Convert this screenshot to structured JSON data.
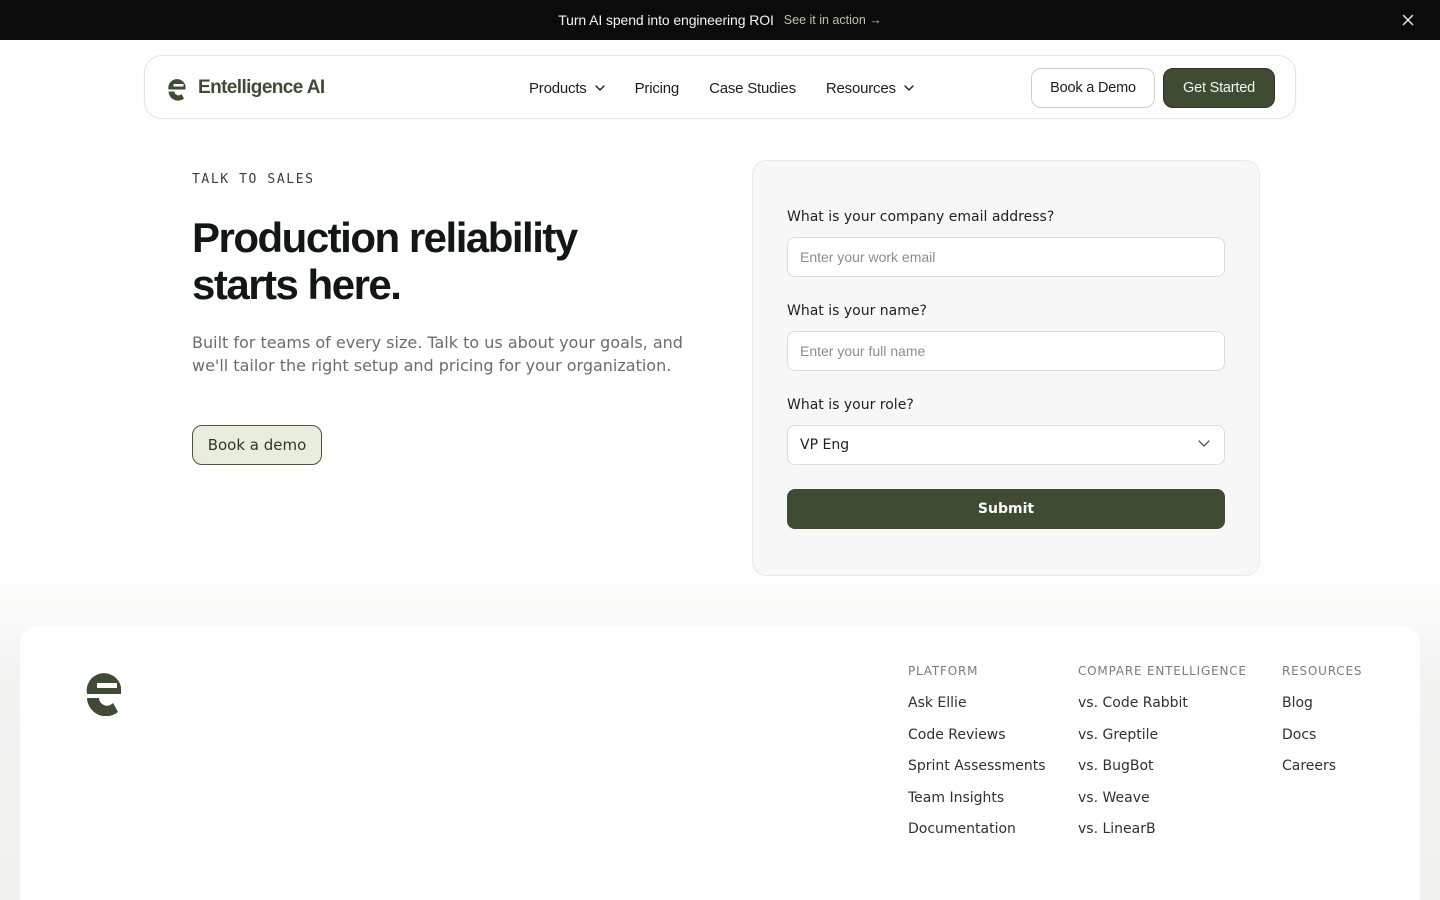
{
  "announcement": {
    "message": "Turn AI spend into engineering ROI",
    "cta": "See it in action →",
    "close_icon": "close-icon"
  },
  "brand": {
    "name": "Entelligence AI",
    "logo_icon": "entelligence-logo-icon",
    "color": "#3f4b33"
  },
  "nav": {
    "items": [
      {
        "label": "Products",
        "has_dropdown": true
      },
      {
        "label": "Pricing",
        "has_dropdown": false
      },
      {
        "label": "Case Studies",
        "has_dropdown": false
      },
      {
        "label": "Resources",
        "has_dropdown": true
      }
    ],
    "book_demo": "Book a Demo",
    "get_started": "Get Started"
  },
  "hero": {
    "eyebrow": "TALK TO SALES",
    "title_line1": "Production reliability",
    "title_line2": "starts here.",
    "subtitle": "Built for teams of every size. Talk to us about your goals, and we'll tailor the right setup and pricing for your organization.",
    "cta": "Book a demo"
  },
  "form": {
    "email_label": "What is your company email address?",
    "email_placeholder": "Enter your work email",
    "email_value": "",
    "name_label": "What is your name?",
    "name_placeholder": "Enter your full name",
    "name_value": "",
    "role_label": "What is your role?",
    "role_value": "VP Eng",
    "submit": "Submit"
  },
  "footer": {
    "columns": [
      {
        "title": "PLATFORM",
        "links": [
          "Ask Ellie",
          "Code Reviews",
          "Sprint Assessments",
          "Team Insights",
          "Documentation"
        ]
      },
      {
        "title": "COMPARE ENTELLIGENCE",
        "links": [
          "vs. Code Rabbit",
          "vs. Greptile",
          "vs. BugBot",
          "vs. Weave",
          "vs. LinearB"
        ]
      },
      {
        "title": "RESOURCES",
        "links": [
          "Blog",
          "Docs",
          "Careers"
        ]
      }
    ]
  },
  "colors": {
    "accent": "#3f4b33",
    "accent_light": "#e9eedc",
    "announcement_bg": "#0b0b0b",
    "announcement_link": "#b7c79a"
  }
}
